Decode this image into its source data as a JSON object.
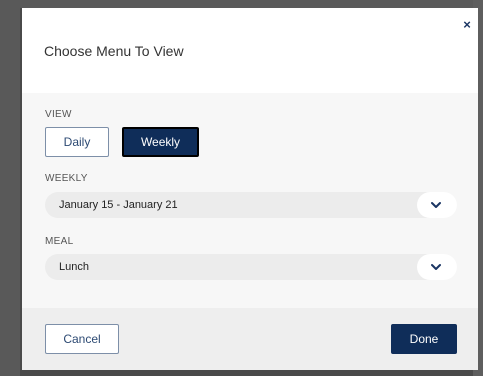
{
  "dialog": {
    "title": "Choose Menu To View",
    "close_symbol": "×"
  },
  "view": {
    "label": "VIEW",
    "options": [
      "Daily",
      "Weekly"
    ],
    "selected": "Weekly"
  },
  "weekly": {
    "label": "WEEKLY",
    "value": "January 15 - January 21"
  },
  "meal": {
    "label": "MEAL",
    "value": "Lunch"
  },
  "footer": {
    "cancel_label": "Cancel",
    "done_label": "Done"
  },
  "colors": {
    "accent": "#0f2d59",
    "outline": "#7d8fa8"
  },
  "icons": {
    "close": "close-icon",
    "dropdown": "chevron-down-icon"
  }
}
